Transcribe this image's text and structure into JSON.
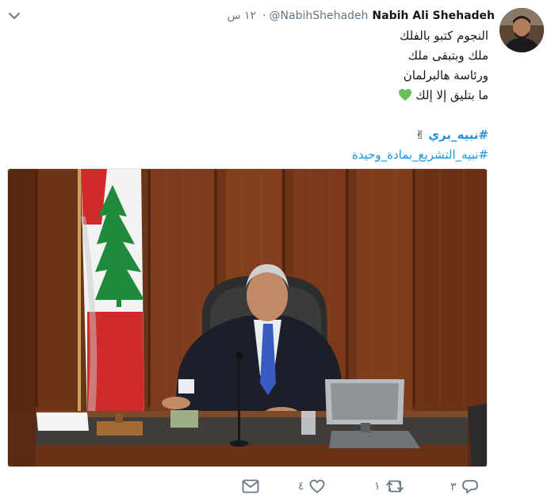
{
  "tweet": {
    "author_name": "Nabih Ali Shehadeh",
    "handle": "@NabihShehadeh",
    "separator": "·",
    "time": "١٢ س",
    "lines": [
      "النجوم كتبو بالفلك",
      "ملك وبتبقى ملك",
      "ورئاسة هالبرلمان",
      "ما بتليق إلا إلك"
    ],
    "hashtags": [
      "#نبيه_بري",
      "#نبيه_التشريع_بمادة_وحيدة"
    ],
    "heart_emoji_color": "#6bbf59"
  },
  "actions": {
    "reply_count": "٣",
    "retweet_count": "١",
    "like_count": "٤"
  },
  "colors": {
    "link": "#1b95e0",
    "muted": "#657786",
    "wood": "#7a3b1c",
    "flag_red": "#d12a2a",
    "cedar_green": "#1f8a3a"
  },
  "icons": [
    "chevron-down-icon",
    "green-heart-icon",
    "victory-hand-icon",
    "reply-icon",
    "retweet-icon",
    "like-icon",
    "message-icon"
  ]
}
